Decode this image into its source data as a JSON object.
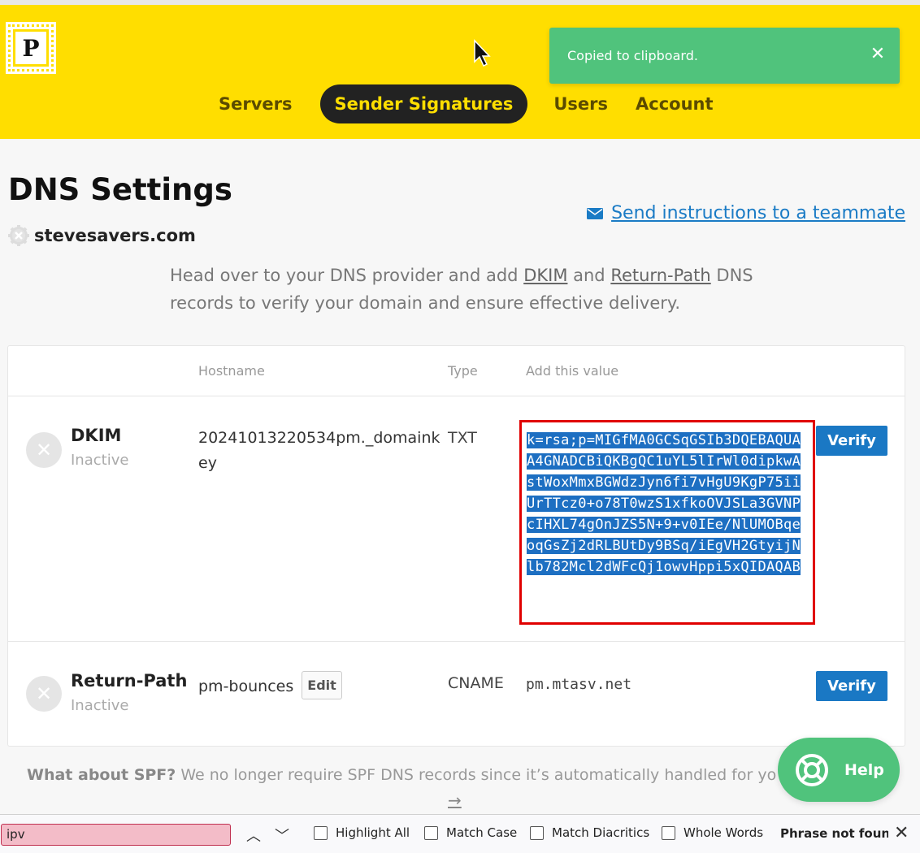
{
  "header": {
    "logo_letter": "P",
    "nav": [
      {
        "label": "Servers",
        "active": false
      },
      {
        "label": "Sender Signatures",
        "active": true
      },
      {
        "label": "Users",
        "active": false
      },
      {
        "label": "Account",
        "active": false
      }
    ],
    "brand_color": "#ffde00"
  },
  "toast": {
    "message": "Copied to clipboard.",
    "close_icon": "close-icon",
    "color": "#50c37c"
  },
  "page": {
    "title": "DNS Settings",
    "domain": "stevesavers.com",
    "send_link": "Send instructions to a teammate",
    "intro_pre": "Head over to your DNS provider and add ",
    "intro_dkim": "DKIM",
    "intro_and": " and ",
    "intro_rp": "Return-Path",
    "intro_post": " DNS records to verify your domain and ensure effective delivery."
  },
  "table": {
    "headers": {
      "hostname": "Hostname",
      "type": "Type",
      "value": "Add this value"
    },
    "rows": [
      {
        "name": "DKIM",
        "status": "Inactive",
        "hostname": "20241013220534pm._domainkey",
        "type": "TXT",
        "value": "k=rsa;p=MIGfMA0GCSqGSIb3DQEBAQUAA4GNADCBiQKBgQC1uYL5lIrWl0dipkwAstWoxMmxBGWdzJyn6fi7vHgU9KgP75iiUrTTcz0+o78T0wzS1xfkoOVJSLa3GVNPcIHXL74gOnJZS5N+9+v0IEe/NlUMOBqeoqGsZj2dRLBUtDy9BSq/iEgVH2GtyijNlb782Mcl2dWFcQj1owvHppi5xQIDAQAB",
        "verify": "Verify"
      },
      {
        "name": "Return-Path",
        "status": "Inactive",
        "hostname": "pm-bounces",
        "edit": "Edit",
        "type": "CNAME",
        "value": "pm.mtasv.net",
        "verify": "Verify"
      }
    ]
  },
  "spf": {
    "bold": "What about SPF?",
    "text": " We no longer require SPF DNS records since it’s automatically handled for yo",
    "arrow": "→"
  },
  "help": {
    "label": "Help"
  },
  "findbar": {
    "query": "ipv",
    "options": [
      "Highlight All",
      "Match Case",
      "Match Diacritics",
      "Whole Words"
    ],
    "status": "Phrase not found"
  }
}
